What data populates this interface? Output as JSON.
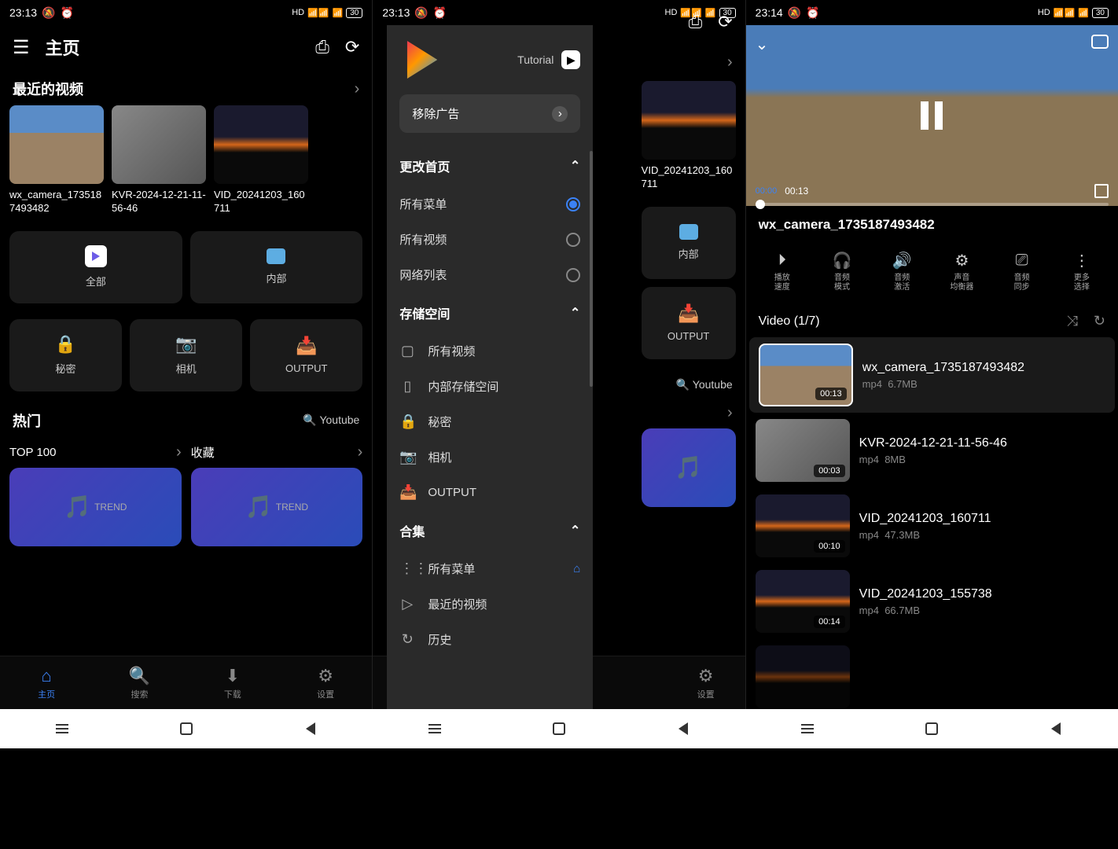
{
  "status": {
    "time1": "23:13",
    "time3": "23:14",
    "battery": "30",
    "signal": "HD"
  },
  "s1": {
    "title": "主页",
    "recent_title": "最近的视频",
    "videos": [
      {
        "name": "wx_camera_1735187493482"
      },
      {
        "name": "KVR-2024-12-21-11-56-46"
      },
      {
        "name": "VID_20241203_160711"
      }
    ],
    "tiles_row1": [
      {
        "label": "全部"
      },
      {
        "label": "内部"
      }
    ],
    "tiles_row2": [
      {
        "label": "秘密"
      },
      {
        "label": "相机"
      },
      {
        "label": "OUTPUT"
      }
    ],
    "hot_title": "热门",
    "youtube": "Youtube",
    "top100": "TOP 100",
    "favorites": "收藏",
    "trend": "TREND",
    "nav": [
      {
        "label": "主页"
      },
      {
        "label": "搜索"
      },
      {
        "label": "下载"
      },
      {
        "label": "设置"
      }
    ]
  },
  "s2": {
    "tutorial": "Tutorial",
    "remove_ads": "移除广告",
    "change_home": "更改首页",
    "home_opts": [
      {
        "label": "所有菜单",
        "checked": true
      },
      {
        "label": "所有视频",
        "checked": false
      },
      {
        "label": "网络列表",
        "checked": false
      }
    ],
    "storage": "存储空间",
    "storage_items": [
      {
        "label": "所有视频",
        "icon": "▢"
      },
      {
        "label": "内部存储空间",
        "icon": "📱"
      },
      {
        "label": "秘密",
        "icon": "🔒"
      },
      {
        "label": "相机",
        "icon": "📷"
      },
      {
        "label": "OUTPUT",
        "icon": "📥"
      }
    ],
    "collection": "合集",
    "col_items": [
      {
        "label": "所有菜单",
        "icon": "⋮⋮⋮"
      },
      {
        "label": "最近的视频",
        "icon": "▷"
      },
      {
        "label": "历史",
        "icon": "↻"
      }
    ],
    "bg": {
      "video3_name": "VID_20241203_160711",
      "tile_internal": "内部",
      "tile_output": "OUTPUT",
      "youtube": "Youtube",
      "nav_settings": "设置"
    }
  },
  "s3": {
    "current_time": "00:13",
    "title": "wx_camera_1735187493482",
    "tools": [
      {
        "l1": "播放",
        "l2": "速度"
      },
      {
        "l1": "音频",
        "l2": "模式"
      },
      {
        "l1": "音频",
        "l2": "激活"
      },
      {
        "l1": "声音",
        "l2": "均衡器"
      },
      {
        "l1": "音频",
        "l2": "同步"
      },
      {
        "l1": "更多",
        "l2": "选择"
      }
    ],
    "queue_title": "Video (1/7)",
    "queue": [
      {
        "name": "wx_camera_1735187493482",
        "fmt": "mp4",
        "size": "6.7MB",
        "dur": "00:13",
        "thumb": "sky",
        "active": true
      },
      {
        "name": "KVR-2024-12-21-11-56-46",
        "fmt": "mp4",
        "size": "8MB",
        "dur": "00:03",
        "thumb": "gray"
      },
      {
        "name": "VID_20241203_160711",
        "fmt": "mp4",
        "size": "47.3MB",
        "dur": "00:10",
        "thumb": "sunset"
      },
      {
        "name": "VID_20241203_155738",
        "fmt": "mp4",
        "size": "66.7MB",
        "dur": "00:14",
        "thumb": "sunset"
      }
    ]
  }
}
